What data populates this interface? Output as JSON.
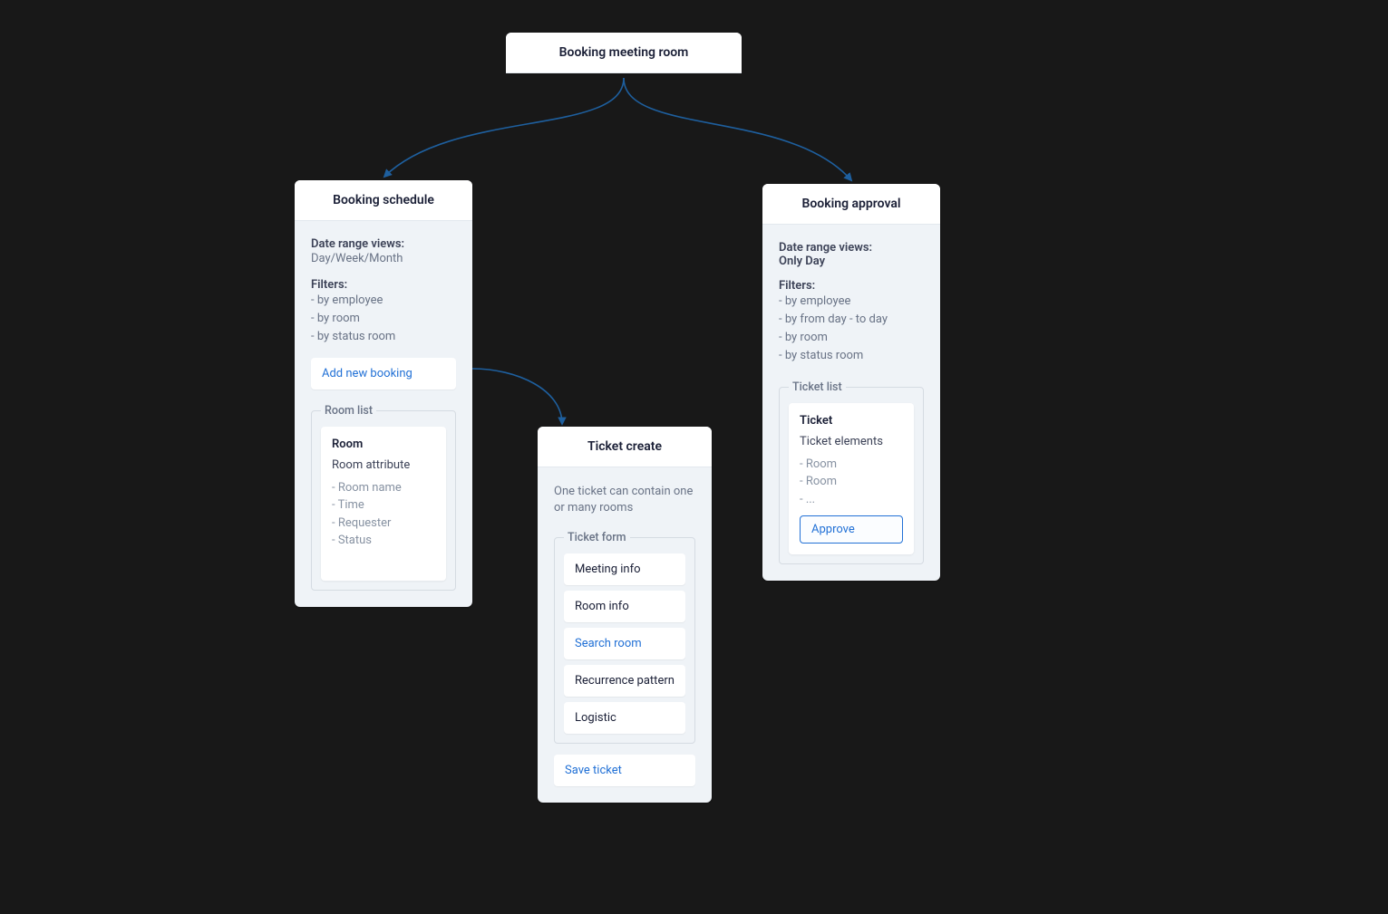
{
  "root": {
    "title": "Booking meeting room"
  },
  "schedule": {
    "title": "Booking schedule",
    "date_label": "Date range views:",
    "date_value": "Day/Week/Month",
    "filters_label": "Filters:",
    "filters": [
      "- by employee",
      "- by room",
      "- by status room"
    ],
    "add_booking": "Add new booking",
    "room_list_legend": "Room list",
    "room_card": {
      "title": "Room",
      "attr_label": "Room attribute",
      "attrs": [
        "- Room name",
        "- Time",
        "- Requester",
        "- Status"
      ]
    }
  },
  "approval": {
    "title": "Booking approval",
    "date_label": "Date range views:",
    "date_value": "Only Day",
    "filters_label": "Filters:",
    "filters": [
      "- by employee",
      "- by from day - to day",
      "- by room",
      "- by status room"
    ],
    "ticket_list_legend": "Ticket list",
    "ticket_card": {
      "title": "Ticket",
      "elements_label": "Ticket elements",
      "elements": [
        "- Room",
        "- Room",
        "- ..."
      ],
      "approve_label": "Approve"
    }
  },
  "ticket": {
    "title": "Ticket create",
    "desc": "One ticket can contain one or many rooms",
    "form_legend": "Ticket form",
    "fields": [
      {
        "label": "Meeting info",
        "link": false
      },
      {
        "label": "Room info",
        "link": false
      },
      {
        "label": "Search room",
        "link": true
      },
      {
        "label": "Recurrence pattern",
        "link": false
      },
      {
        "label": "Logistic",
        "link": false
      }
    ],
    "save_label": "Save ticket"
  },
  "colors": {
    "connector": "#1e5f9e"
  }
}
